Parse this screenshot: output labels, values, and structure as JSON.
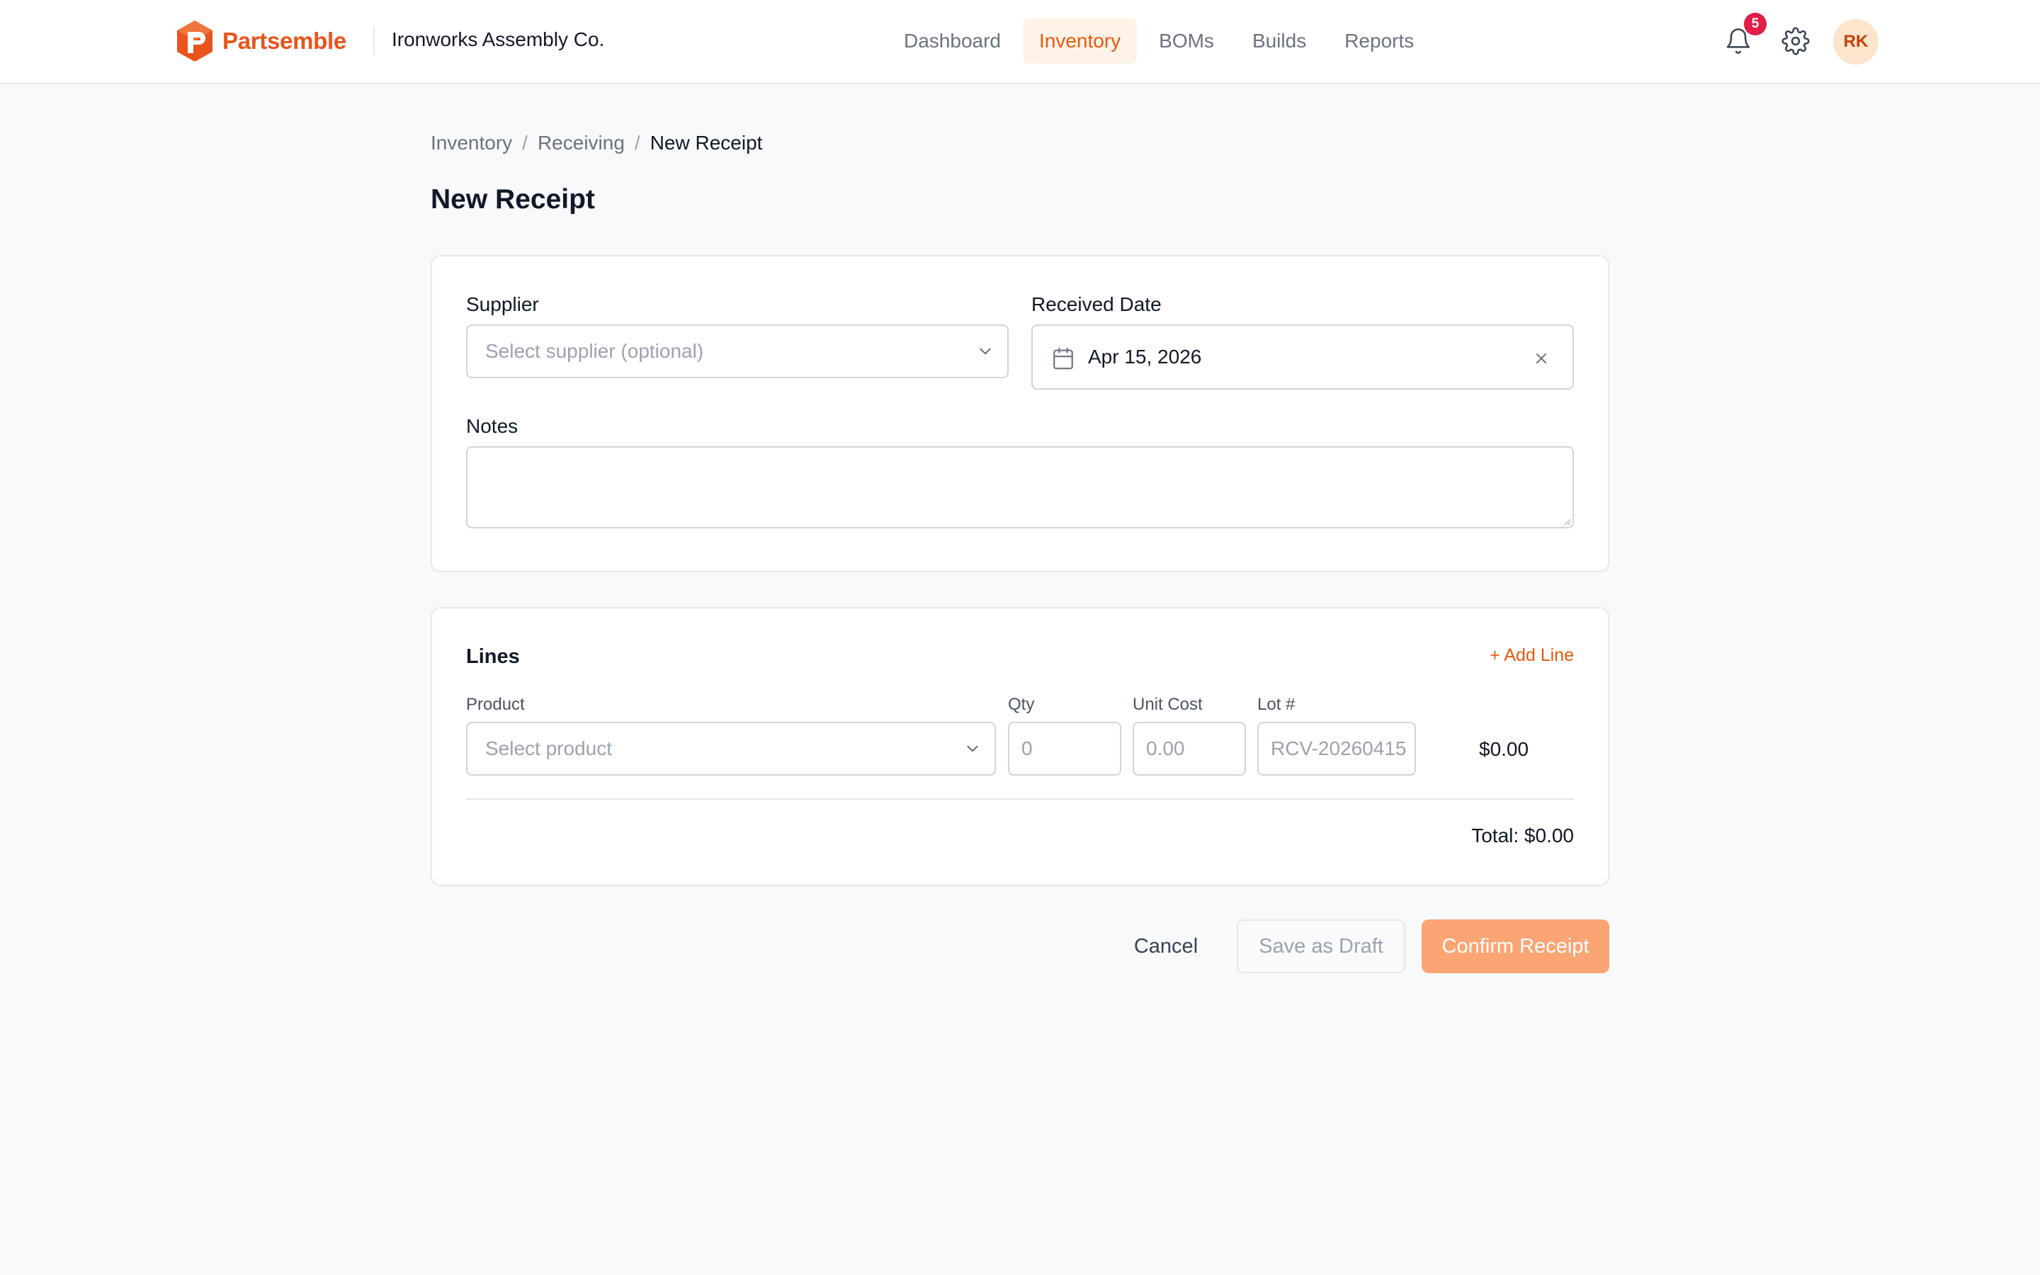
{
  "app": {
    "brand": "Partsemble",
    "organization": "Ironworks Assembly Co.",
    "accent_color": "#ea580c"
  },
  "nav": {
    "items": [
      {
        "label": "Dashboard",
        "active": false
      },
      {
        "label": "Inventory",
        "active": true
      },
      {
        "label": "BOMs",
        "active": false
      },
      {
        "label": "Builds",
        "active": false
      },
      {
        "label": "Reports",
        "active": false
      }
    ]
  },
  "header": {
    "notification_count": "5",
    "notification_icon": "bell-icon",
    "settings_icon": "gear-icon",
    "user_initials": "RK"
  },
  "breadcrumb": {
    "items": [
      "Inventory",
      "Receiving",
      "New Receipt"
    ],
    "separator": "/"
  },
  "page": {
    "title": "New Receipt"
  },
  "form": {
    "supplier": {
      "label": "Supplier",
      "placeholder": "Select supplier (optional)",
      "value": ""
    },
    "received_date": {
      "label": "Received Date",
      "value": "Apr 15, 2026"
    },
    "notes": {
      "label": "Notes",
      "value": ""
    }
  },
  "lines": {
    "title": "Lines",
    "add_label": "+ Add Line",
    "columns": {
      "product": "Product",
      "qty": "Qty",
      "unit_cost": "Unit Cost",
      "lot": "Lot #"
    },
    "rows": [
      {
        "product_placeholder": "Select product",
        "qty_placeholder": "0",
        "unit_cost_placeholder": "0.00",
        "lot_placeholder": "RCV-20260415",
        "amount": "$0.00"
      }
    ],
    "total_label": "Total: $0.00"
  },
  "actions": {
    "cancel": "Cancel",
    "save_draft": "Save as Draft",
    "confirm": "Confirm Receipt"
  }
}
